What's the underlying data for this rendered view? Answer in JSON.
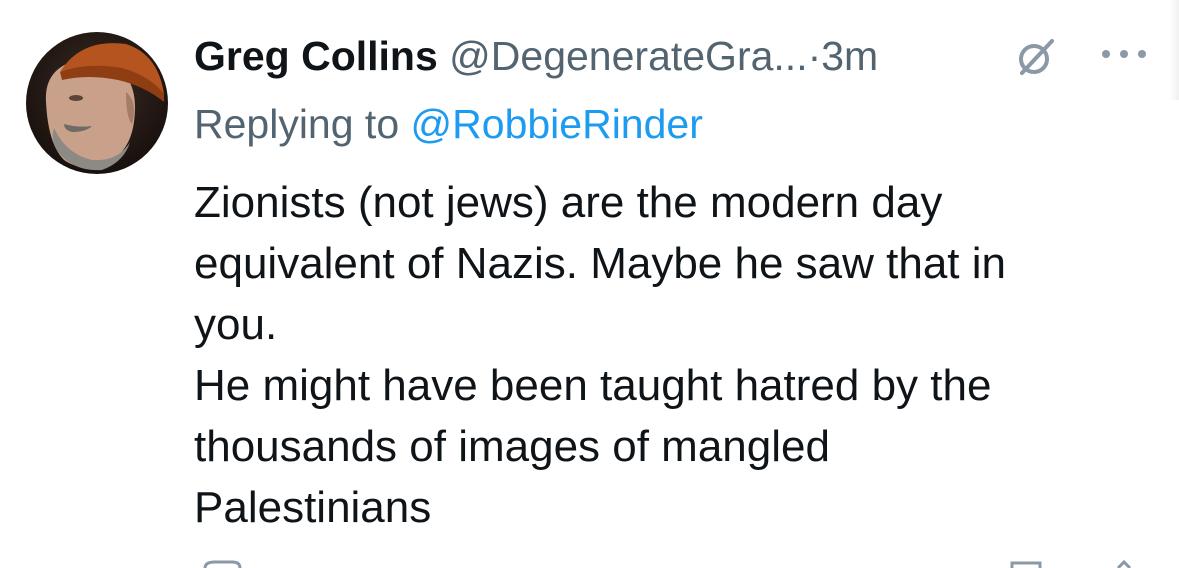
{
  "tweet": {
    "author": {
      "display_name": "Greg Collins",
      "handle": "@DegenerateGra...",
      "avatar_icon": "user-avatar-photo"
    },
    "separator": "·",
    "timestamp": "3m",
    "verified_icon": "slashed-circle-icon",
    "more_icon": "more-options-icon",
    "reply_prefix": "Replying to",
    "reply_target": "@RobbieRinder",
    "body_lines": [
      "Zionists (not jews) are the modern day",
      "equivalent of Nazis. Maybe he saw that in",
      "you.",
      "He might have been taught hatred by the",
      "thousands of images of mangled",
      "Palestinians"
    ]
  },
  "colors": {
    "primary_text": "#0f1419",
    "secondary_text": "#536471",
    "link": "#1d9bf0",
    "background": "#ffffff"
  }
}
